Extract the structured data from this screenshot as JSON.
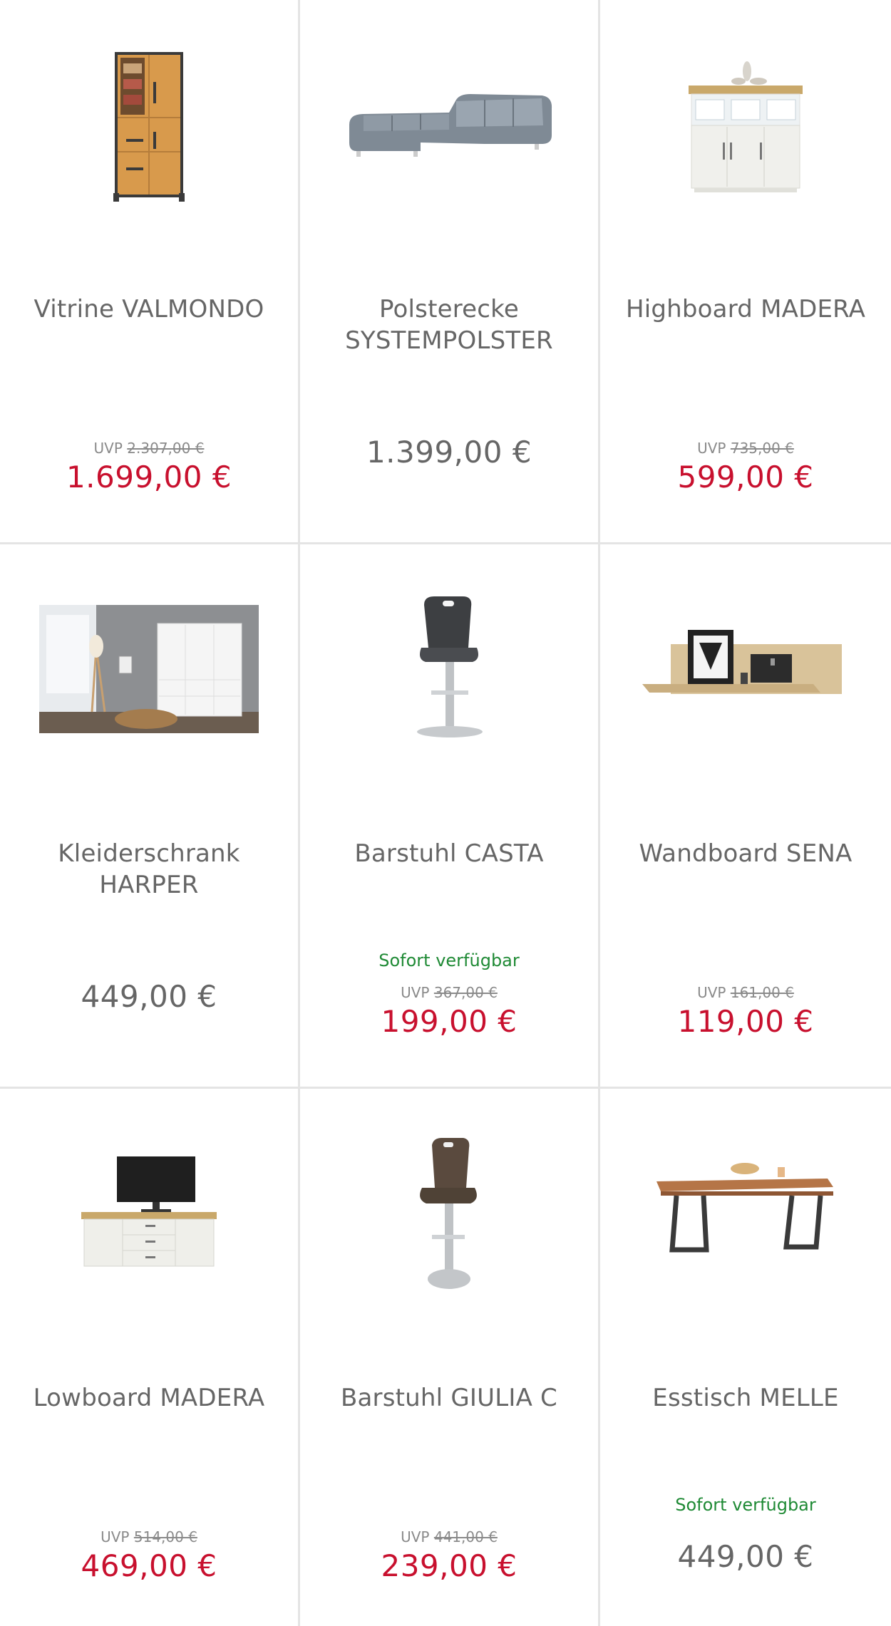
{
  "products": [
    {
      "name": "Vitrine VALMONDO",
      "uvp_label": "UVP",
      "uvp_price": "2.307,00 €",
      "price": "1.699,00 €",
      "availability": ""
    },
    {
      "name": "Polsterecke SYSTEMPOLSTER",
      "uvp_label": "",
      "uvp_price": "",
      "price": "1.399,00 €",
      "availability": ""
    },
    {
      "name": "Highboard MADERA",
      "uvp_label": "UVP",
      "uvp_price": "735,00 €",
      "price": "599,00 €",
      "availability": ""
    },
    {
      "name": "Kleiderschrank HARPER",
      "uvp_label": "",
      "uvp_price": "",
      "price": "449,00 €",
      "availability": ""
    },
    {
      "name": "Barstuhl CASTA",
      "uvp_label": "UVP",
      "uvp_price": "367,00 €",
      "price": "199,00 €",
      "availability": "Sofort verfügbar"
    },
    {
      "name": "Wandboard SENA",
      "uvp_label": "UVP",
      "uvp_price": "161,00 €",
      "price": "119,00 €",
      "availability": ""
    },
    {
      "name": "Lowboard MADERA",
      "uvp_label": "UVP",
      "uvp_price": "514,00 €",
      "price": "469,00 €",
      "availability": ""
    },
    {
      "name": "Barstuhl GIULIA C",
      "uvp_label": "UVP",
      "uvp_price": "441,00 €",
      "price": "239,00 €",
      "availability": ""
    },
    {
      "name": "Esstisch MELLE",
      "uvp_label": "",
      "uvp_price": "",
      "price": "449,00 €",
      "availability": "Sofort verfügbar"
    }
  ],
  "colors": {
    "sale_price": "#c8102e",
    "regular_price": "#666666",
    "availability": "#1f8a35",
    "divider": "#e4e4e4"
  }
}
